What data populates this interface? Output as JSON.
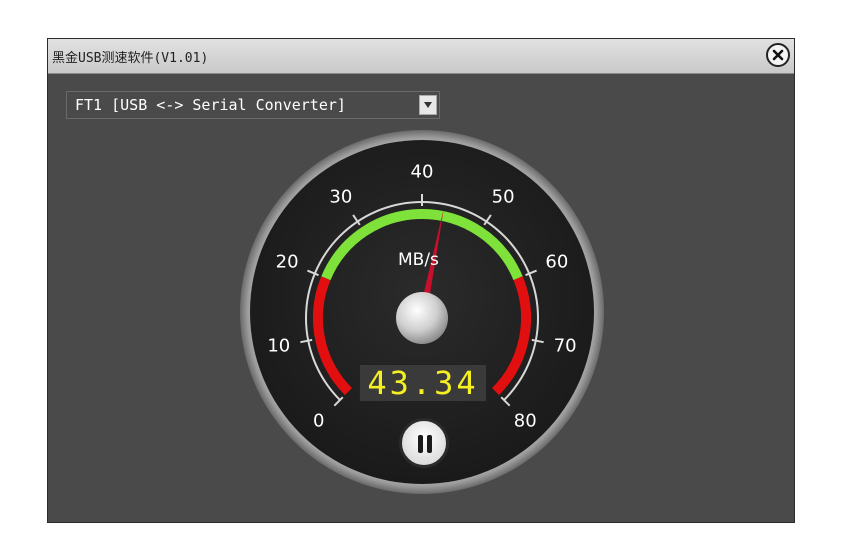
{
  "window": {
    "title": "黑金USB测速软件(V1.01)"
  },
  "device": {
    "selected": "FT1 [USB <-> Serial Converter]"
  },
  "gauge": {
    "unit": "MB/s",
    "min": 0,
    "max": 80,
    "value": 43.34,
    "readout": "43.34",
    "ticks": [
      "0",
      "10",
      "20",
      "30",
      "40",
      "50",
      "60",
      "70",
      "80"
    ],
    "zones": [
      {
        "from": 0,
        "to": 20,
        "color": "#e10f0f"
      },
      {
        "from": 20,
        "to": 60,
        "color": "#7fe23a"
      },
      {
        "from": 60,
        "to": 80,
        "color": "#e10f0f"
      }
    ],
    "needle_color": "#c8102e",
    "readout_color": "#f6f021"
  },
  "icons": {
    "close": "close-icon",
    "dropdown": "chevron-down-icon",
    "pause": "pause-icon"
  }
}
